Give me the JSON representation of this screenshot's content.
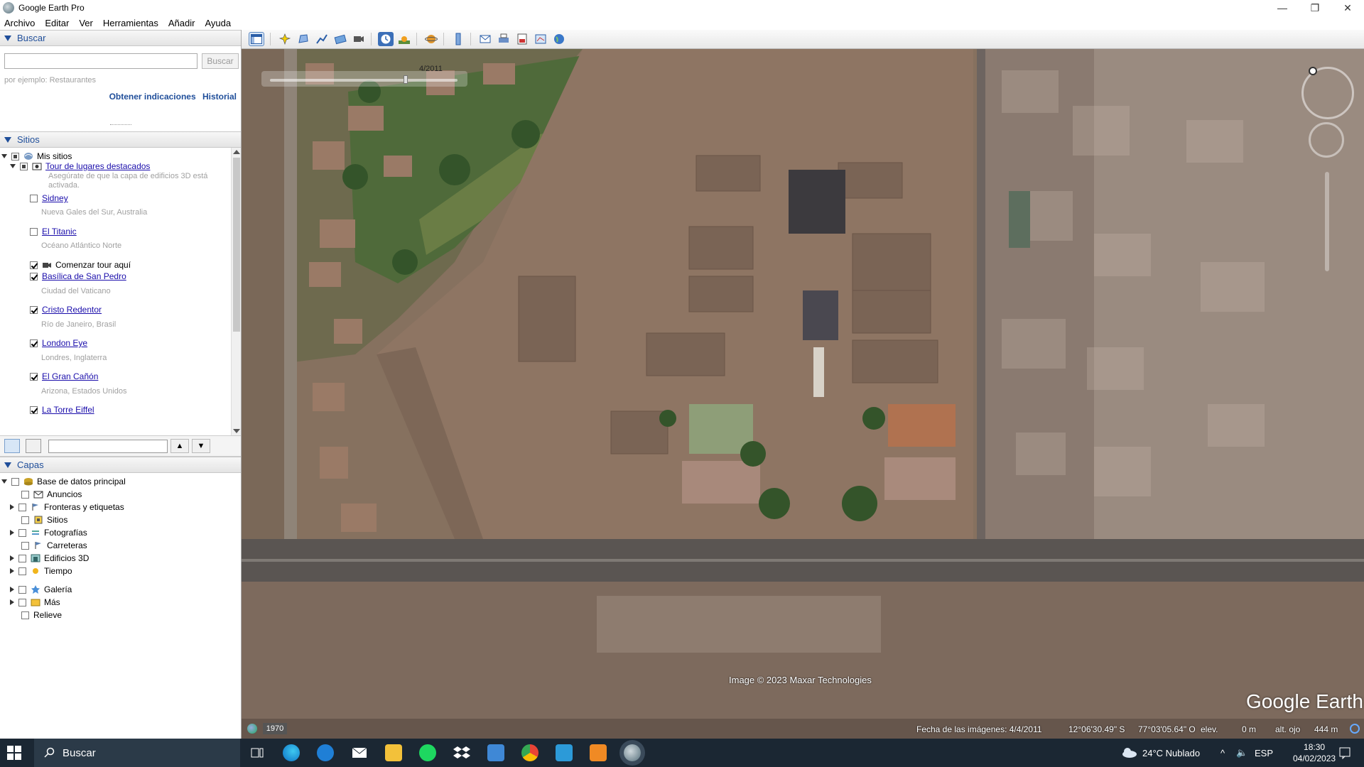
{
  "window": {
    "title": "Google Earth Pro",
    "controls": [
      "—",
      "❐",
      "✕"
    ]
  },
  "menu": [
    "Archivo",
    "Editar",
    "Ver",
    "Herramientas",
    "Añadir",
    "Ayuda"
  ],
  "search": {
    "header": "Buscar",
    "placeholder": "",
    "button": "Buscar",
    "hint": "por ejemplo: Restaurantes",
    "link_directions": "Obtener indicaciones",
    "link_history": "Historial"
  },
  "places": {
    "header": "Sitios",
    "root": "Mis sitios",
    "tour": {
      "label": "Tour de lugares destacados",
      "note_line1": "Asegúrate de que la capa de edificios 3D está",
      "note_line2": "activada."
    },
    "items": [
      {
        "label": "Sidney",
        "sub": "Nueva Gales del Sur, Australia",
        "checked": false
      },
      {
        "label": "El Titanic",
        "sub": "Océano Atlántico Norte",
        "checked": false
      },
      {
        "label": "Comenzar tour aquí",
        "sub": "",
        "checked": true
      },
      {
        "label": "Basílica de San Pedro",
        "sub": "Ciudad del Vaticano",
        "checked": true
      },
      {
        "label": "Cristo Redentor",
        "sub": "Río de Janeiro, Brasil",
        "checked": true
      },
      {
        "label": "London Eye",
        "sub": "Londres, Inglaterra",
        "checked": true
      },
      {
        "label": "El Gran Cañón",
        "sub": "Arizona, Estados Unidos",
        "checked": true
      },
      {
        "label": "La Torre Eiffel",
        "sub": "",
        "checked": true
      }
    ]
  },
  "layers": {
    "header": "Capas",
    "root": "Base de datos principal",
    "items": [
      "Anuncios",
      "Fronteras y etiquetas",
      "Sitios",
      "Fotografías",
      "Carreteras",
      "Edificios 3D",
      "Tiempo",
      "Galería",
      "Más",
      "Relieve"
    ]
  },
  "map": {
    "time_label": "4/2011",
    "copyright": "Image © 2023 Maxar Technologies",
    "logo": "Google Earth",
    "status": {
      "year": "1970",
      "imagery_date": "Fecha de las imágenes: 4/4/2011",
      "lat": "12°06'30.49\" S",
      "lon": "77°03'05.64\" O",
      "elev_label": "elev.",
      "elev_value": "0 m",
      "eye_label": "alt. ojo",
      "eye_value": "444 m"
    }
  },
  "taskbar": {
    "search": "Buscar",
    "weather": "24°C  Nublado",
    "lang": "ESP",
    "time": "18:30",
    "date": "04/02/2023"
  },
  "colors": {
    "accent": "#1f4e9a",
    "link": "#1a0dab",
    "taskbar": "#1b2733"
  }
}
